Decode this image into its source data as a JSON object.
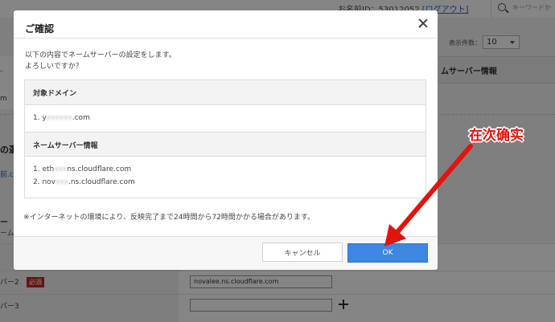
{
  "background": {
    "account_label": "お名前ID：53012052",
    "logout_label": "[ログアウト]",
    "search_placeholder": "キーワードか",
    "display_count_label": "表示件数：",
    "display_count_value": "10",
    "table_header": "ムサーバー情報",
    "left_cell_dash": "-",
    "left_cell_m": "m",
    "left_fragment_no": "の選",
    "left_link_fragment": "前.c",
    "left_fragment_nu": "ー",
    "left_fragment_nu2": "ーム",
    "rows": [
      {
        "label": "バー",
        "value": ""
      },
      {
        "label": "バー2",
        "badge": "必須",
        "value": "novalee.ns.cloudflare.com"
      },
      {
        "label": "バー3",
        "value": ""
      }
    ]
  },
  "modal": {
    "title": "ご確認",
    "message_line1": "以下の内容でネームサーバーの設定をします。",
    "message_line2": "よろしいですか？",
    "domain_section": {
      "header": "対象ドメイン",
      "prefix": "1. y",
      "blurred": "xxxxxx",
      "suffix": ".com"
    },
    "ns_section": {
      "header": "ネームサーバー情報",
      "line1_prefix": "1. eth",
      "line1_blurred": "xxx",
      "line1_suffix": "ns.cloudflare.com",
      "line2_prefix": "2. nov",
      "line2_blurred": "xxx",
      "line2_suffix": ".ns.cloudflare.com"
    },
    "note": "※インターネットの環境により、反映完了まで24時間から72時間かかる場合があります。",
    "cancel_label": "キャンセル",
    "ok_label": "OK"
  },
  "annotation": {
    "text": "在次确实",
    "color": "#e5120d"
  }
}
